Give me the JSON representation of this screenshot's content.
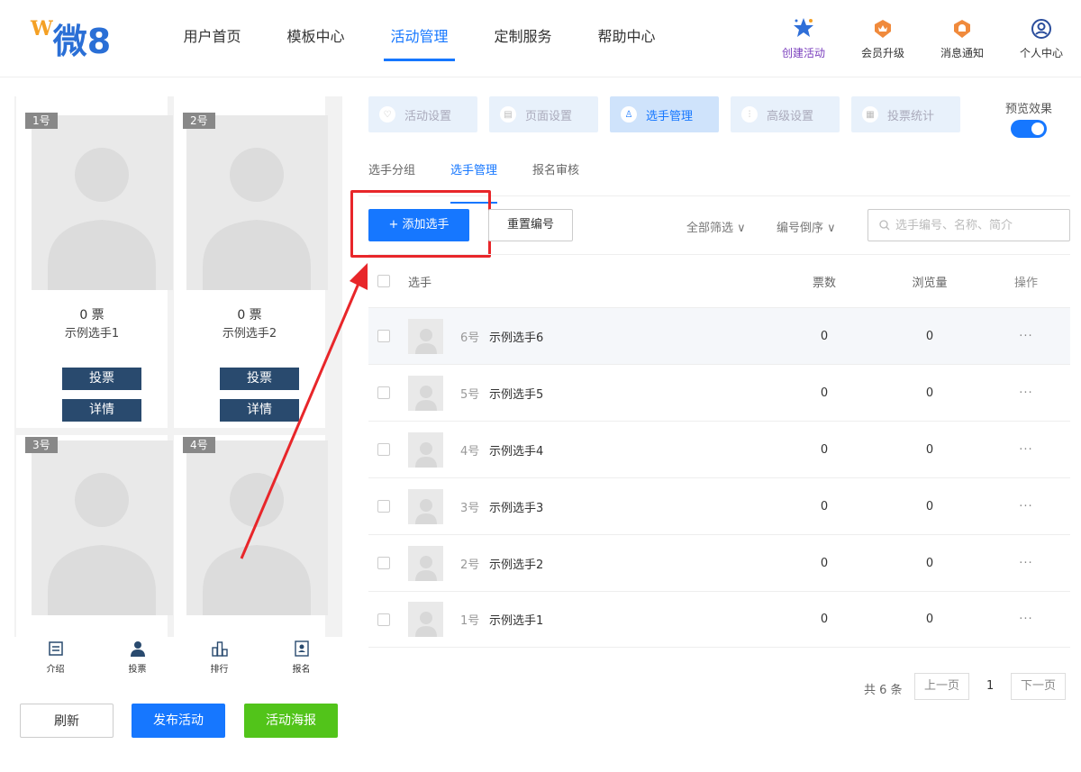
{
  "header": {
    "logo_mark": "W",
    "logo_text": "微8",
    "nav": [
      "用户首页",
      "模板中心",
      "活动管理",
      "定制服务",
      "帮助中心"
    ],
    "tools": [
      {
        "label": "创建活动",
        "icon": "star-icon"
      },
      {
        "label": "会员升级",
        "icon": "crown-badge-icon"
      },
      {
        "label": "消息通知",
        "icon": "bell-badge-icon"
      },
      {
        "label": "个人中心",
        "icon": "user-circle-icon"
      }
    ]
  },
  "preview": {
    "cards": [
      {
        "badge": "1号",
        "votes": "0 票",
        "name": "示例选手1"
      },
      {
        "badge": "2号",
        "votes": "0 票",
        "name": "示例选手2"
      },
      {
        "badge": "3号"
      },
      {
        "badge": "4号"
      }
    ],
    "vote_label": "投票",
    "detail_label": "详情",
    "bottom_nav": [
      "介绍",
      "投票",
      "排行",
      "报名"
    ]
  },
  "footer_buttons": {
    "refresh": "刷新",
    "publish": "发布活动",
    "poster": "活动海报"
  },
  "steps": [
    "活动设置",
    "页面设置",
    "选手管理",
    "高级设置",
    "投票统计"
  ],
  "preview_toggle": {
    "label": "预览效果",
    "on": true
  },
  "subtabs": [
    "选手分组",
    "选手管理",
    "报名审核"
  ],
  "toolbar": {
    "add": "+ 添加选手",
    "reset": "重置编号",
    "filter_all": "全部筛选 ∨",
    "sort": "编号倒序 ∨",
    "search_placeholder": "选手编号、名称、简介"
  },
  "table": {
    "headers": {
      "player": "选手",
      "votes": "票数",
      "views": "浏览量",
      "ops": "操作"
    },
    "rows": [
      {
        "num": "6号",
        "name": "示例选手6",
        "votes": "0",
        "views": "0",
        "ops": "···"
      },
      {
        "num": "5号",
        "name": "示例选手5",
        "votes": "0",
        "views": "0",
        "ops": "···"
      },
      {
        "num": "4号",
        "name": "示例选手4",
        "votes": "0",
        "views": "0",
        "ops": "···"
      },
      {
        "num": "3号",
        "name": "示例选手3",
        "votes": "0",
        "views": "0",
        "ops": "···"
      },
      {
        "num": "2号",
        "name": "示例选手2",
        "votes": "0",
        "views": "0",
        "ops": "···"
      },
      {
        "num": "1号",
        "name": "示例选手1",
        "votes": "0",
        "views": "0",
        "ops": "···"
      }
    ]
  },
  "pagination": {
    "total": "共 6 条",
    "prev": "上一页",
    "current": "1",
    "next": "下一页"
  },
  "colors": {
    "primary": "#1677ff",
    "navy": "#294a6e",
    "green": "#52c41a",
    "annotation_red": "#e8262a"
  }
}
